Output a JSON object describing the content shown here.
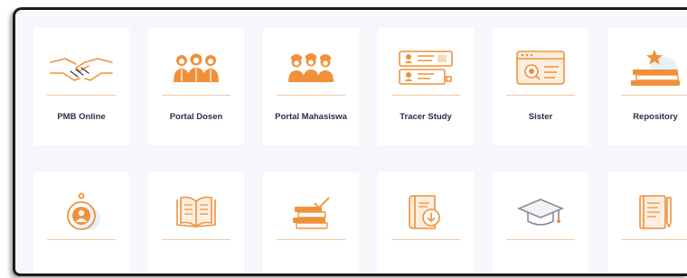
{
  "cards_row1": [
    {
      "label": "PMB Online",
      "icon": "handshake-icon"
    },
    {
      "label": "Portal Dosen",
      "icon": "lecturers-icon"
    },
    {
      "label": "Portal Mahasiswa",
      "icon": "students-icon"
    },
    {
      "label": "Tracer Study",
      "icon": "id-cards-icon"
    },
    {
      "label": "Sister",
      "icon": "browser-search-icon"
    },
    {
      "label": "Repository",
      "icon": "book-stack-star-icon"
    }
  ],
  "cards_row2": [
    {
      "label": "",
      "icon": "user-badge-icon"
    },
    {
      "label": "",
      "icon": "open-book-icon"
    },
    {
      "label": "",
      "icon": "stacked-books-check-icon"
    },
    {
      "label": "",
      "icon": "book-download-icon"
    },
    {
      "label": "",
      "icon": "graduation-cap-icon"
    },
    {
      "label": "",
      "icon": "journal-pen-icon"
    }
  ],
  "colors": {
    "accent": "#f0913a",
    "card": "#ffffff",
    "background": "#f6f7fa",
    "text": "#2a2f45"
  }
}
